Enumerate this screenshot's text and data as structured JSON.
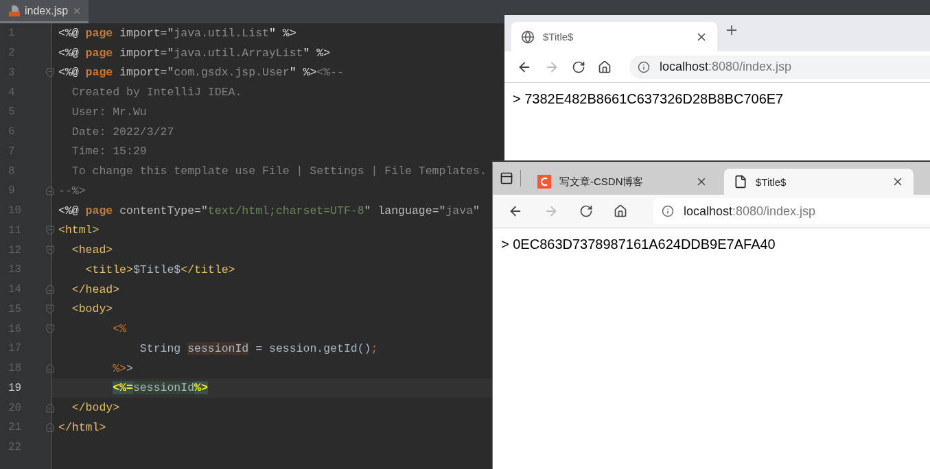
{
  "editor": {
    "tab": {
      "label": "index.jsp",
      "selected": true
    },
    "lines": [
      {
        "number": "1",
        "current": false,
        "fold_start": false,
        "fold_end": false,
        "tokens": [
          {
            "t": "<%@ ",
            "kind": "jsp"
          },
          {
            "t": "page",
            "kind": "keyword"
          },
          {
            "t": " import=\"",
            "kind": "attr"
          },
          {
            "t": "java.util.List",
            "kind": "string"
          },
          {
            "t": "\" %>",
            "kind": "jsp"
          }
        ]
      },
      {
        "number": "2",
        "current": false,
        "fold_start": false,
        "fold_end": false,
        "tokens": [
          {
            "t": "<%@ ",
            "kind": "jsp"
          },
          {
            "t": "page",
            "kind": "keyword"
          },
          {
            "t": " import=\"",
            "kind": "attr"
          },
          {
            "t": "java.util.ArrayList",
            "kind": "string"
          },
          {
            "t": "\" %>",
            "kind": "jsp"
          }
        ]
      },
      {
        "number": "3",
        "current": false,
        "fold_start": true,
        "fold_end": false,
        "tokens": [
          {
            "t": "<%@ ",
            "kind": "jsp"
          },
          {
            "t": "page",
            "kind": "keyword"
          },
          {
            "t": " import=\"",
            "kind": "attr"
          },
          {
            "t": "com.gsdx.jsp.User",
            "kind": "string"
          },
          {
            "t": "\" %>",
            "kind": "jsp"
          },
          {
            "t": "<%--",
            "kind": "comment"
          }
        ]
      },
      {
        "number": "4",
        "current": false,
        "fold_start": false,
        "fold_end": false,
        "tokens": [
          {
            "t": "  Created by IntelliJ IDEA.",
            "kind": "comment"
          }
        ]
      },
      {
        "number": "5",
        "current": false,
        "fold_start": false,
        "fold_end": false,
        "tokens": [
          {
            "t": "  User: Mr.Wu",
            "kind": "comment"
          }
        ]
      },
      {
        "number": "6",
        "current": false,
        "fold_start": false,
        "fold_end": false,
        "tokens": [
          {
            "t": "  Date: 2022/3/27",
            "kind": "comment"
          }
        ]
      },
      {
        "number": "7",
        "current": false,
        "fold_start": false,
        "fold_end": false,
        "tokens": [
          {
            "t": "  Time: 15:29",
            "kind": "comment"
          }
        ]
      },
      {
        "number": "8",
        "current": false,
        "fold_start": false,
        "fold_end": false,
        "tokens": [
          {
            "t": "  To change this template use File | Settings | File Templates.",
            "kind": "comment"
          }
        ]
      },
      {
        "number": "9",
        "current": false,
        "fold_start": false,
        "fold_end": true,
        "tokens": [
          {
            "t": "--%>",
            "kind": "comment"
          }
        ]
      },
      {
        "number": "10",
        "current": false,
        "fold_start": false,
        "fold_end": false,
        "tokens": [
          {
            "t": "<%@ ",
            "kind": "jsp"
          },
          {
            "t": "page",
            "kind": "keyword"
          },
          {
            "t": " contentType=\"",
            "kind": "attr"
          },
          {
            "t": "text/html;charset=UTF-8",
            "kind": "value"
          },
          {
            "t": "\" language=\"",
            "kind": "attr"
          },
          {
            "t": "java",
            "kind": "string"
          },
          {
            "t": "\"",
            "kind": "attr"
          }
        ]
      },
      {
        "number": "11",
        "current": false,
        "fold_start": true,
        "fold_end": false,
        "tokens": [
          {
            "t": "<html>",
            "kind": "tag"
          }
        ]
      },
      {
        "number": "12",
        "current": false,
        "fold_start": true,
        "fold_end": false,
        "tokens": [
          {
            "t": "  <head>",
            "kind": "tag"
          }
        ]
      },
      {
        "number": "13",
        "current": false,
        "fold_start": false,
        "fold_end": false,
        "tokens": [
          {
            "t": "    <title>",
            "kind": "tag"
          },
          {
            "t": "$Title$",
            "kind": "code"
          },
          {
            "t": "</title>",
            "kind": "tag"
          }
        ]
      },
      {
        "number": "14",
        "current": false,
        "fold_start": false,
        "fold_end": true,
        "tokens": [
          {
            "t": "  </head>",
            "kind": "tag"
          }
        ]
      },
      {
        "number": "15",
        "current": false,
        "fold_start": true,
        "fold_end": false,
        "tokens": [
          {
            "t": "  <body>",
            "kind": "tag"
          }
        ]
      },
      {
        "number": "16",
        "current": false,
        "fold_start": true,
        "fold_end": false,
        "tokens": [
          {
            "t": "        <%",
            "kind": "scriptlet"
          }
        ]
      },
      {
        "number": "17",
        "current": false,
        "fold_start": false,
        "fold_end": false,
        "tokens": [
          {
            "t": "            String ",
            "kind": "code"
          },
          {
            "t": "sessionId",
            "kind": "decl"
          },
          {
            "t": " = session.getId()",
            "kind": "code"
          },
          {
            "t": ";",
            "kind": "scriptlet"
          }
        ]
      },
      {
        "number": "18",
        "current": false,
        "fold_start": false,
        "fold_end": true,
        "tokens": [
          {
            "t": "        %>",
            "kind": "scriptlet"
          },
          {
            "t": ">",
            "kind": "code"
          }
        ]
      },
      {
        "number": "19",
        "current": true,
        "fold_start": false,
        "fold_end": false,
        "tokens": [
          {
            "t": "        <%=",
            "kind": "match"
          },
          {
            "t": "sessionId",
            "kind": "ref"
          },
          {
            "t": "%>",
            "kind": "match"
          }
        ]
      },
      {
        "number": "20",
        "current": false,
        "fold_start": false,
        "fold_end": true,
        "tokens": [
          {
            "t": "  </body>",
            "kind": "tag"
          }
        ]
      },
      {
        "number": "21",
        "current": false,
        "fold_start": false,
        "fold_end": true,
        "tokens": [
          {
            "t": "</html>",
            "kind": "tag"
          }
        ]
      },
      {
        "number": "22",
        "current": false,
        "fold_start": false,
        "fold_end": false
      }
    ]
  },
  "browsers": [
    {
      "kind": "chrome",
      "tabs": [
        {
          "label": "$Title$",
          "selected": true
        }
      ],
      "forward_disabled": true,
      "url_host": "localhost",
      "url_path": ":8080/index.jsp",
      "content": "> 7382E482B8661C637326D28B8BC706E7"
    },
    {
      "kind": "edge",
      "tabs": [
        {
          "label": "写文章-CSDN博客",
          "selected": false
        },
        {
          "label": "$Title$",
          "selected": true
        }
      ],
      "forward_disabled": true,
      "url_host": "localhost",
      "url_path": ":8080/index.jsp",
      "content": "> 0EC863D7378987161A624DDB9E7AFA40"
    }
  ]
}
